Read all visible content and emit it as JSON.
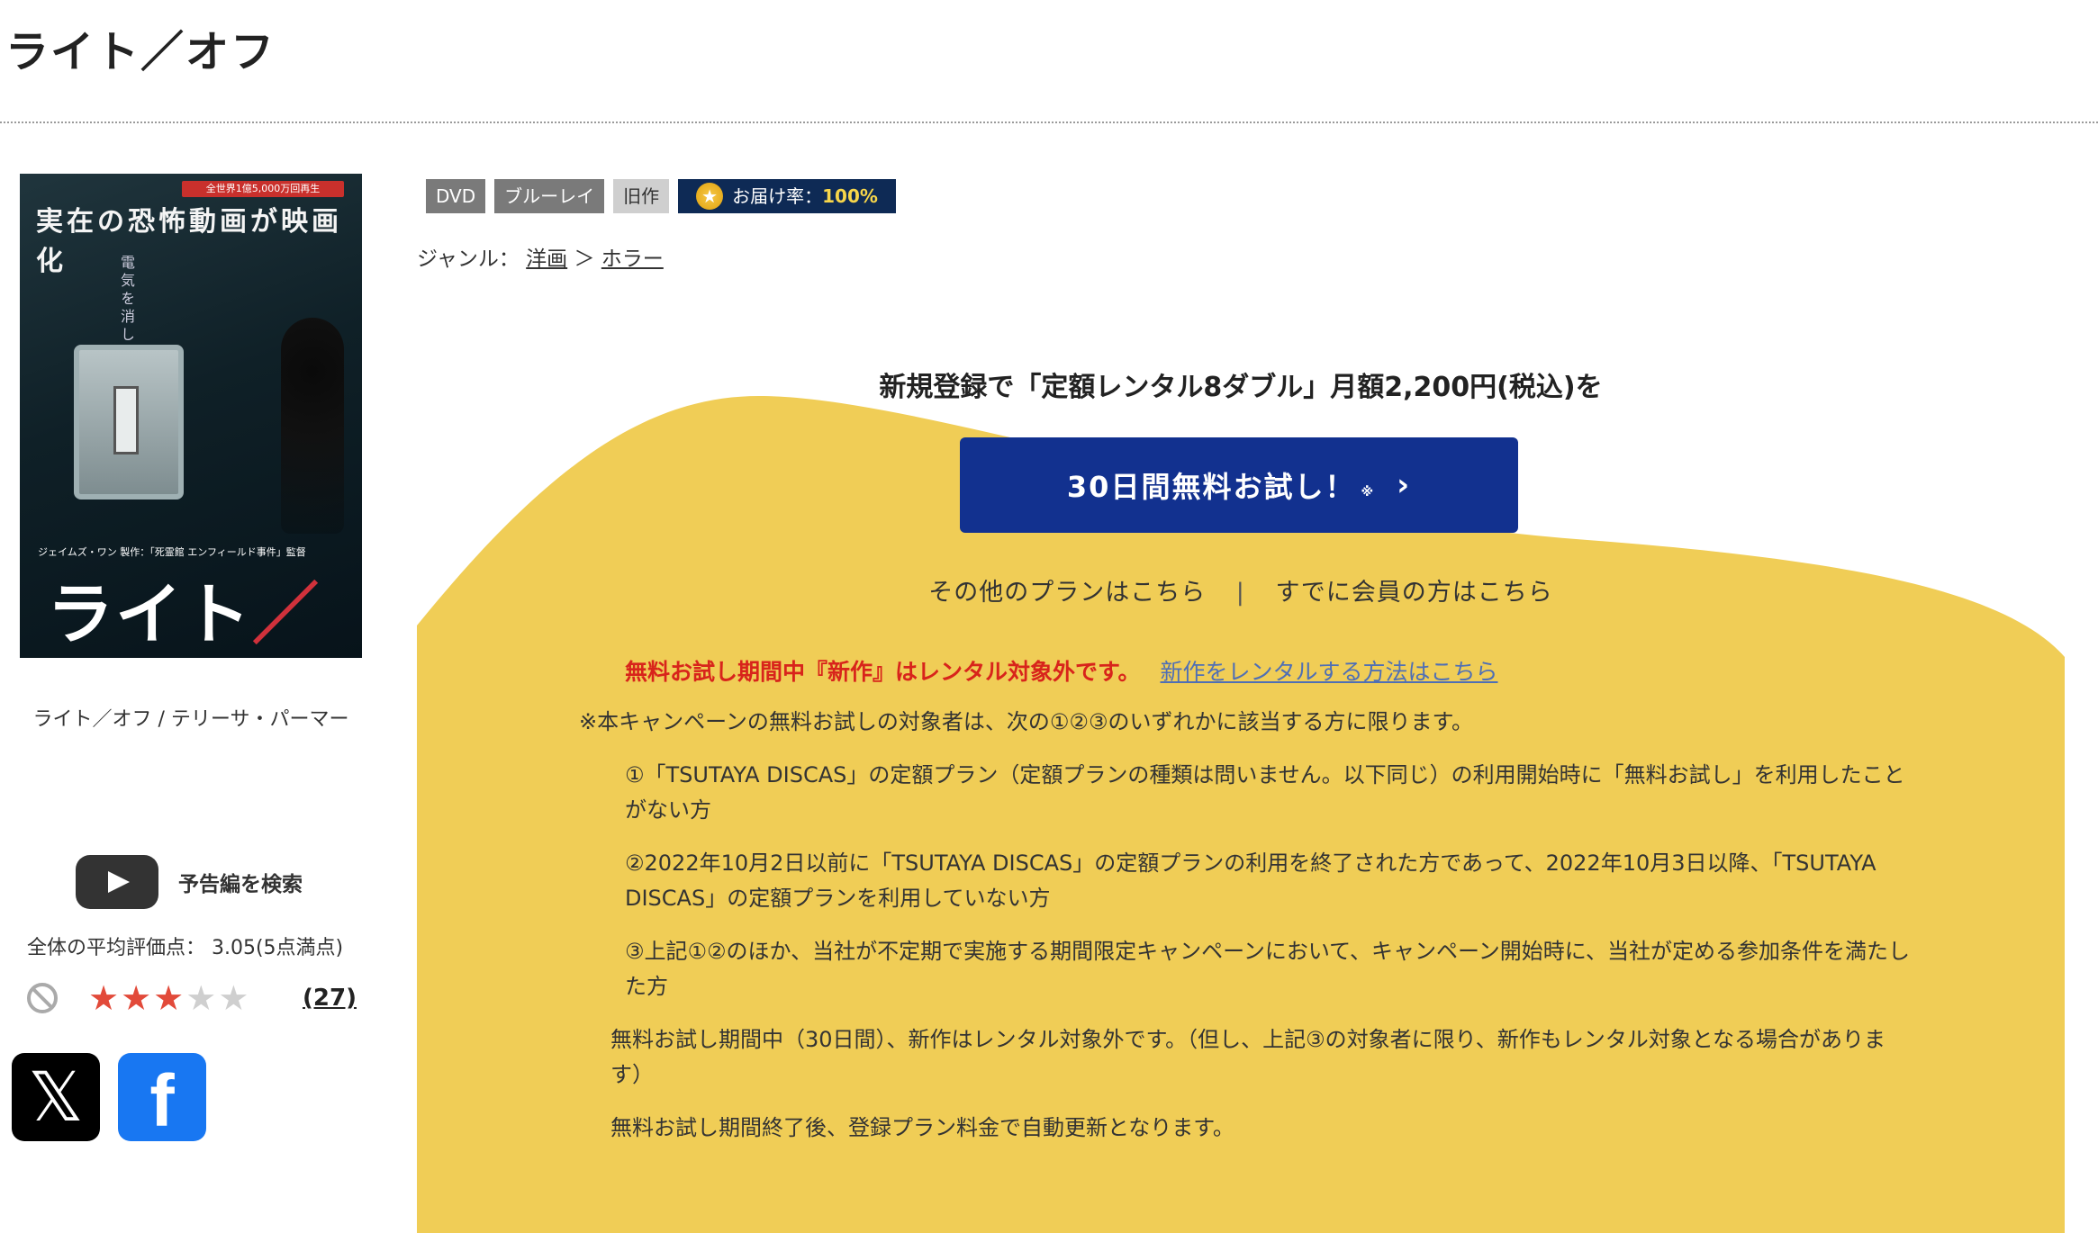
{
  "page": {
    "title": "ライト／オフ"
  },
  "poster": {
    "banner": "全世界1億5,000万回再生",
    "tagline": "実在の恐怖動画が映画化",
    "vertical_text": "電気を消したら、",
    "credit": "ジェイムズ・ワン 製作：「死霊館 エンフィールド事件」監督",
    "title_part1": "ライト",
    "title_part2": "／オフ"
  },
  "item": {
    "caption": "ライト／オフ / テリーサ・パーマー"
  },
  "trailer": {
    "label": "予告編を検索",
    "icon": "play-icon"
  },
  "rating": {
    "text": "全体の平均評価点：  3.05(5点満点)",
    "score": 3.05,
    "max": 5,
    "filled_stars": 3,
    "review_count": "(27)",
    "star_glyph": "★",
    "star_on_color": "#e24a3a",
    "star_off_color": "#cfcfcf"
  },
  "sns": {
    "x_glyph": "𝕏",
    "facebook_glyph": "f"
  },
  "tags": {
    "dvd": "DVD",
    "bluray": "ブルーレイ",
    "old": "旧作",
    "delivery_label": "お届け率：",
    "delivery_value": "100%"
  },
  "genre": {
    "label": "ジャンル：",
    "level1": "洋画",
    "separator": "＞",
    "level2": "ホラー"
  },
  "promo": {
    "heading": "新規登録で「定額レンタル8ダブル」月額2,200円(税込)を",
    "cta_label": "30日間無料お試し！",
    "cta_note": "※",
    "cta_chevron": "›",
    "other_plans": "その他のプランはこちら",
    "link_separator": "|",
    "members": "すでに会員の方はこちら",
    "warning": "無料お試し期間中『新作』はレンタル対象外です。",
    "warning_link": "新作をレンタルする方法はこちら",
    "intro": "※本キャンペーンの無料お試しの対象者は、次の①②③のいずれかに該当する方に限ります。",
    "conditions": [
      "①「TSUTAYA DISCAS」の定額プラン（定額プランの種類は問いません。以下同じ）の利用開始時に「無料お試し」を利用したことがない方",
      "②2022年10月2日以前に「TSUTAYA DISCAS」の定額プランの利用を終了された方であって、2022年10月3日以降、「TSUTAYA DISCAS」の定額プランを利用していない方",
      "③上記①②のほか、当社が不定期で実施する期間限定キャンペーンにおいて、キャンペーン開始時に、当社が定める参加条件を満たした方"
    ],
    "note1": "無料お試し期間中（30日間）、新作はレンタル対象外です。（但し、上記③の対象者に限り、新作もレンタル対象となる場合があります）",
    "note2": "無料お試し期間終了後、登録プラン料金で自動更新となります。"
  },
  "colors": {
    "promo_bg": "#f0cd56",
    "cta_bg": "#12318f",
    "warning": "#d8241b",
    "link": "#4f6fb5",
    "tag_dark": "#0e2a55"
  }
}
